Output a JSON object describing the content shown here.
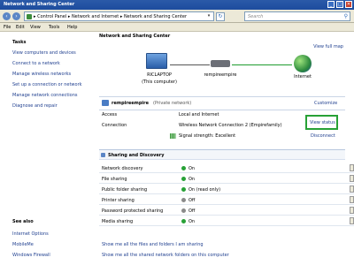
{
  "window": {
    "title": "Network and Sharing Center"
  },
  "address": {
    "path": "▸ Control Panel ▸ Network and Internet ▸ Network and Sharing Center",
    "search_placeholder": "Search"
  },
  "menu": [
    "File",
    "Edit",
    "View",
    "Tools",
    "Help"
  ],
  "sidebar": {
    "tasks_heading": "Tasks",
    "tasks": [
      "View computers and devices",
      "Connect to a network",
      "Manage wireless networks",
      "Set up a connection or network",
      "Manage network connections",
      "Diagnose and repair"
    ],
    "see_also_heading": "See also",
    "see_also": [
      "Internet Options",
      "MobileMe",
      "Windows Firewall"
    ]
  },
  "main": {
    "title": "Network and Sharing Center",
    "view_full_map": "View full map",
    "map": {
      "computer_name": "RICLAPTOP",
      "computer_sub": "(This computer)",
      "network_name": "rempireempire",
      "internet": "Internet"
    },
    "network": {
      "name": "rempireempire",
      "type": "(Private network)",
      "customize": "Customize",
      "access_label": "Access",
      "access_value": "Local and Internet",
      "connection_label": "Connection",
      "connection_value": "Wireless Network Connection 2 (Empirefamily)",
      "view_status": "View status",
      "signal_text": "Signal strength:  Excellent",
      "disconnect": "Disconnect"
    },
    "sharing": {
      "heading": "Sharing and Discovery",
      "rows": [
        {
          "label": "Network discovery",
          "value": "On",
          "color": "#27a136"
        },
        {
          "label": "File sharing",
          "value": "On",
          "color": "#27a136"
        },
        {
          "label": "Public folder sharing",
          "value": "On (read only)",
          "color": "#27a136"
        },
        {
          "label": "Printer sharing",
          "value": "Off",
          "color": "#8a8a8a"
        },
        {
          "label": "Password protected sharing",
          "value": "Off",
          "color": "#8a8a8a"
        },
        {
          "label": "Media sharing",
          "value": "On",
          "color": "#27a136"
        }
      ]
    },
    "bottom_links": [
      "Show me all the files and folders I am sharing",
      "Show me all the shared network folders on this computer"
    ]
  }
}
